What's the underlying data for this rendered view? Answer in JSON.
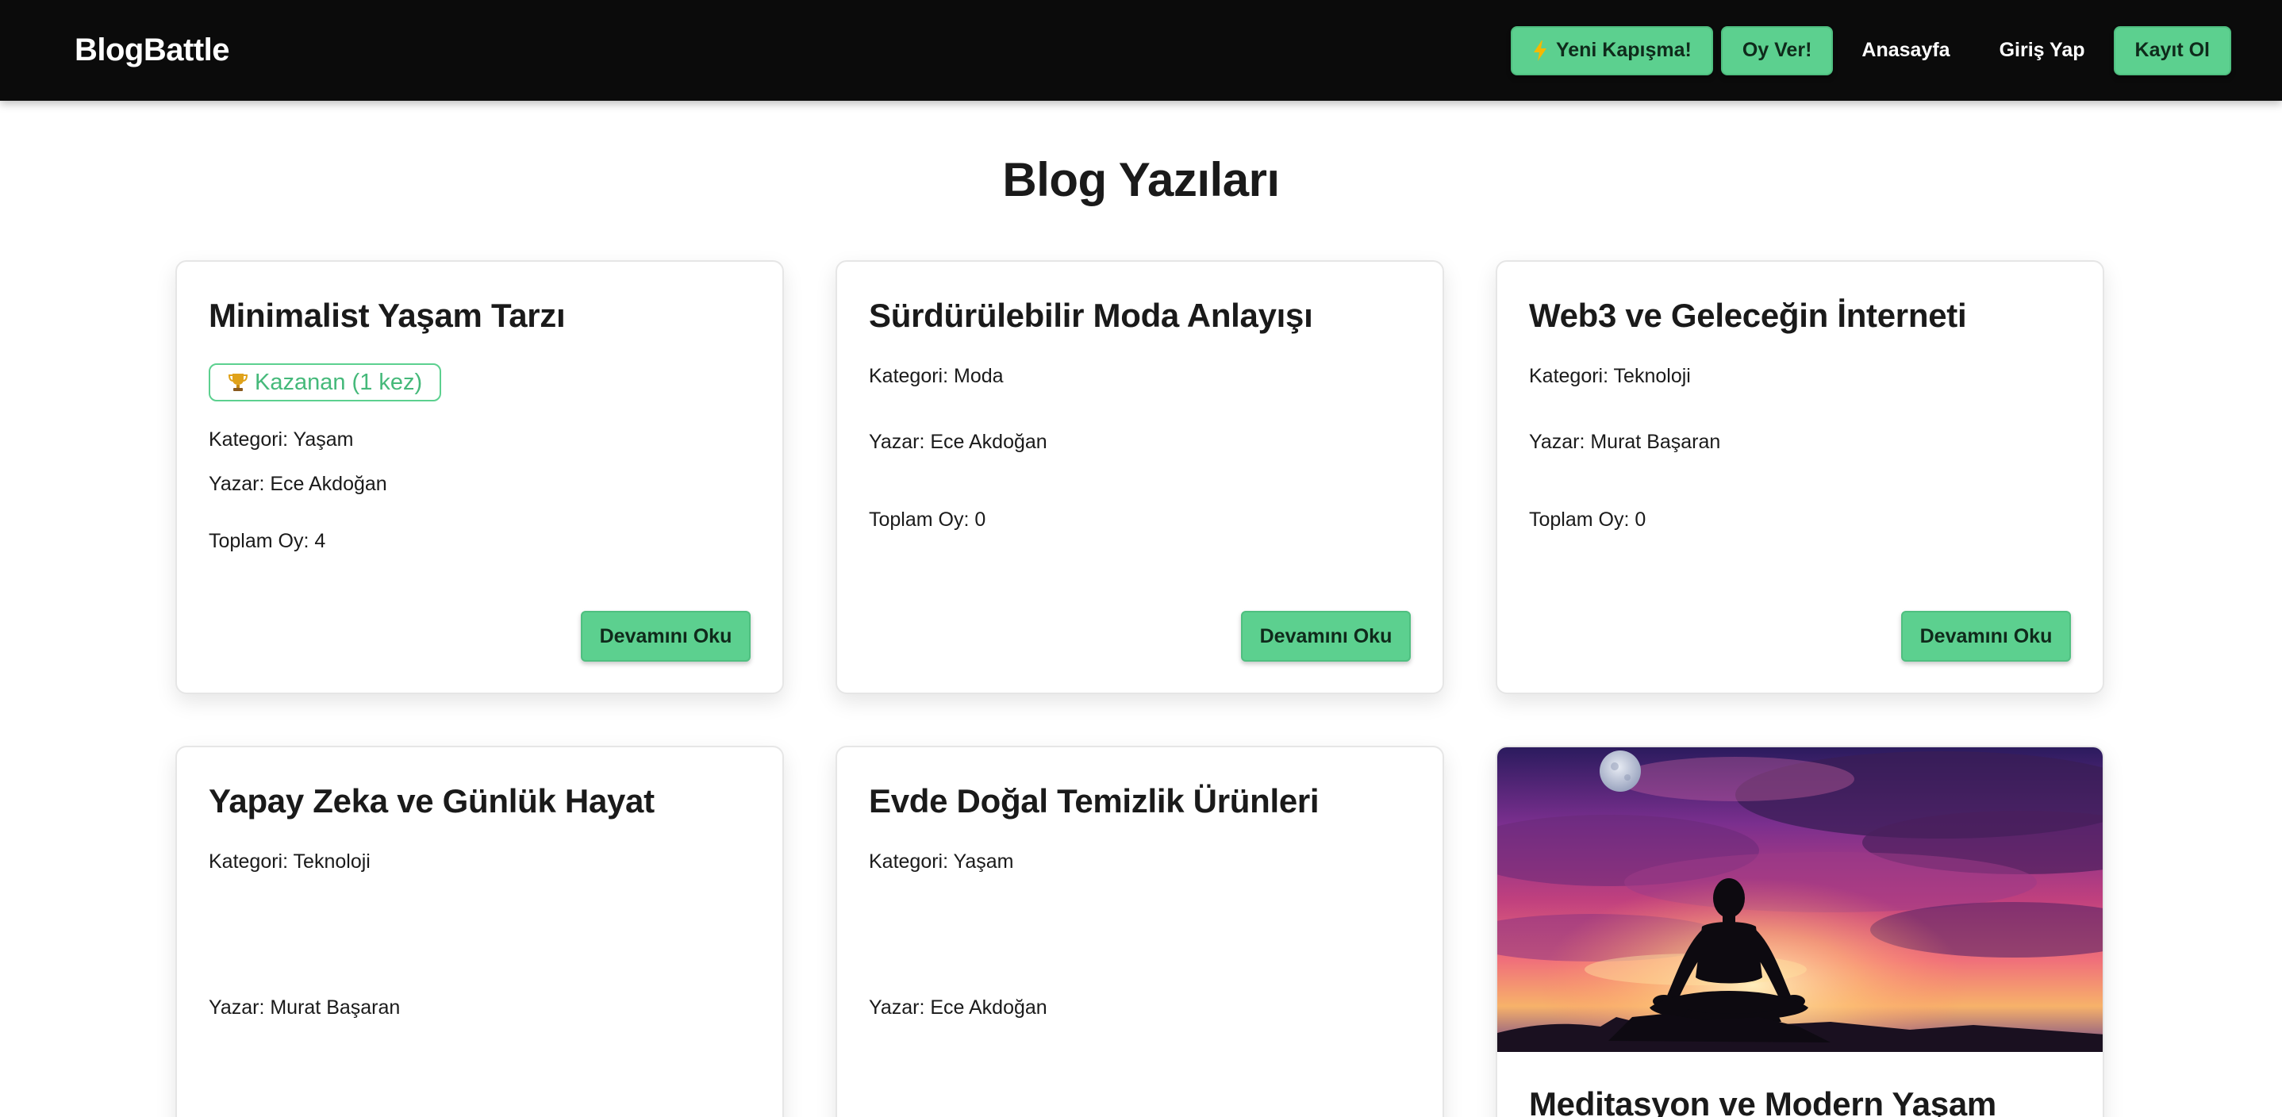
{
  "navbar": {
    "brand": "BlogBattle",
    "new_battle_label": "Yeni Kapışma!",
    "vote_label": "Oy Ver!",
    "home_label": "Anasayfa",
    "login_label": "Giriş Yap",
    "register_label": "Kayıt Ol"
  },
  "page": {
    "title": "Blog Yazıları"
  },
  "colors": {
    "accent": "#5cd08f",
    "navbar_bg": "#0b0b0b"
  },
  "posts": [
    {
      "title": "Minimalist Yaşam Tarzı",
      "badge": "Kazanan (1 kez)",
      "category": "Kategori: Yaşam",
      "author": "Yazar: Ece Akdoğan",
      "votes": "Toplam Oy: 4",
      "read_more": "Devamını Oku"
    },
    {
      "title": "Sürdürülebilir Moda Anlayışı",
      "category": "Kategori: Moda",
      "author": "Yazar: Ece Akdoğan",
      "votes": "Toplam Oy: 0",
      "read_more": "Devamını Oku"
    },
    {
      "title": "Web3 ve Geleceğin İnterneti",
      "category": "Kategori: Teknoloji",
      "author": "Yazar: Murat Başaran",
      "votes": "Toplam Oy: 0",
      "read_more": "Devamını Oku"
    },
    {
      "title": "Yapay Zeka ve Günlük Hayat",
      "category": "Kategori: Teknoloji",
      "author": "Yazar: Murat Başaran"
    },
    {
      "title": "Evde Doğal Temizlik Ürünleri",
      "category": "Kategori: Yaşam",
      "author": "Yazar: Ece Akdoğan"
    },
    {
      "title": "Meditasyon ve Modern Yaşam",
      "image_icon": "meditation-sunset-image"
    }
  ]
}
